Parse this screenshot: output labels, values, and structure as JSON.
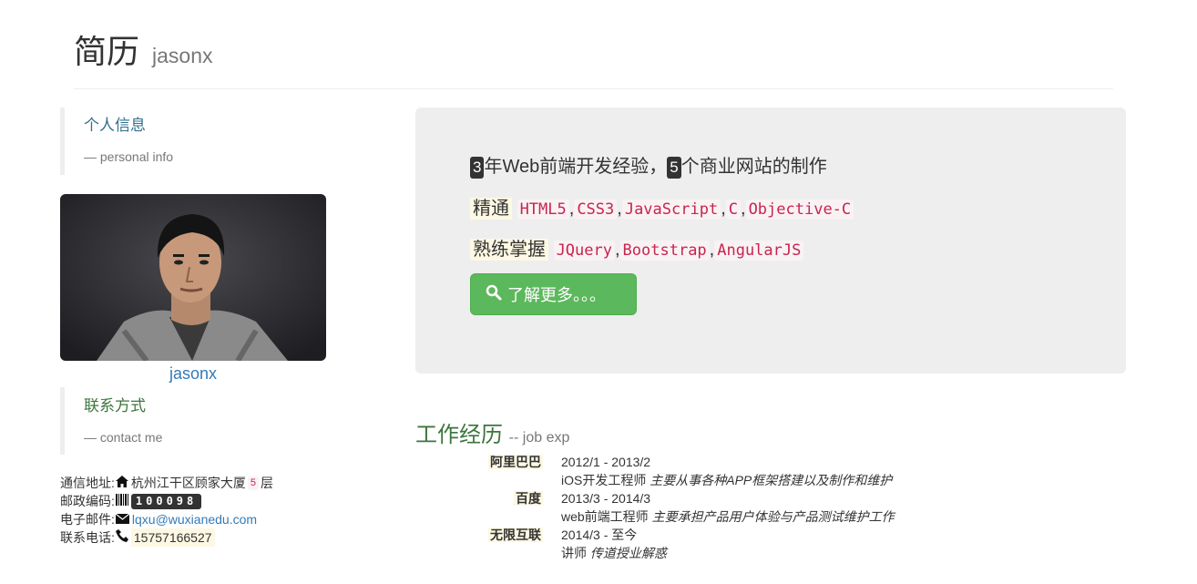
{
  "header": {
    "title": "简历",
    "subtitle": "jasonx"
  },
  "info_section": {
    "title": "个人信息",
    "subtitle": "— personal info"
  },
  "profile": {
    "name": "jasonx"
  },
  "contact_section": {
    "title": "联系方式",
    "subtitle": "— contact me"
  },
  "contact": {
    "address_label": "通信地址:",
    "address": "杭州江干区顾家大厦",
    "floor": "5",
    "floor_suffix": "层",
    "postcode_label": "邮政编码:",
    "postcode": "100098",
    "email_label": "电子邮件:",
    "email": "lqxu@wuxianedu.com",
    "phone_label": "联系电话:",
    "phone": "15757166527"
  },
  "jumbotron": {
    "years": "3",
    "line1_a": "年Web前端开发经验，",
    "sites": "5",
    "line1_b": "个商业网站的制作",
    "proficient_label": "精通",
    "proficient": [
      "HTML5",
      "CSS3",
      "JavaScript",
      "C",
      "Objective-C"
    ],
    "familiar_label": "熟练掌握",
    "familiar": [
      "JQuery",
      "Bootstrap",
      "AngularJS"
    ],
    "button_label": "了解更多。。。",
    "separator": ","
  },
  "experience": {
    "title": "工作经历",
    "subtitle": "-- job exp",
    "items": [
      {
        "company": "阿里巴巴",
        "period": "2012/1 - 2013/2",
        "role": "iOS开发工程师",
        "desc": "主要从事各种APP框架搭建以及制作和维护"
      },
      {
        "company": "百度",
        "period": "2013/3 - 2014/3",
        "role": "web前端工程师",
        "desc": "主要承担产品用户体验与产品测试维护工作"
      },
      {
        "company": "无限互联",
        "period": "2014/3 - 至今",
        "role": "讲师",
        "desc": "传道授业解惑"
      }
    ]
  },
  "colors": {
    "success": "#5cb85c",
    "link": "#337ab7",
    "code": "#c7254e"
  },
  "icons": [
    "home-icon",
    "barcode-icon",
    "envelope-icon",
    "phone-icon",
    "search-icon"
  ]
}
